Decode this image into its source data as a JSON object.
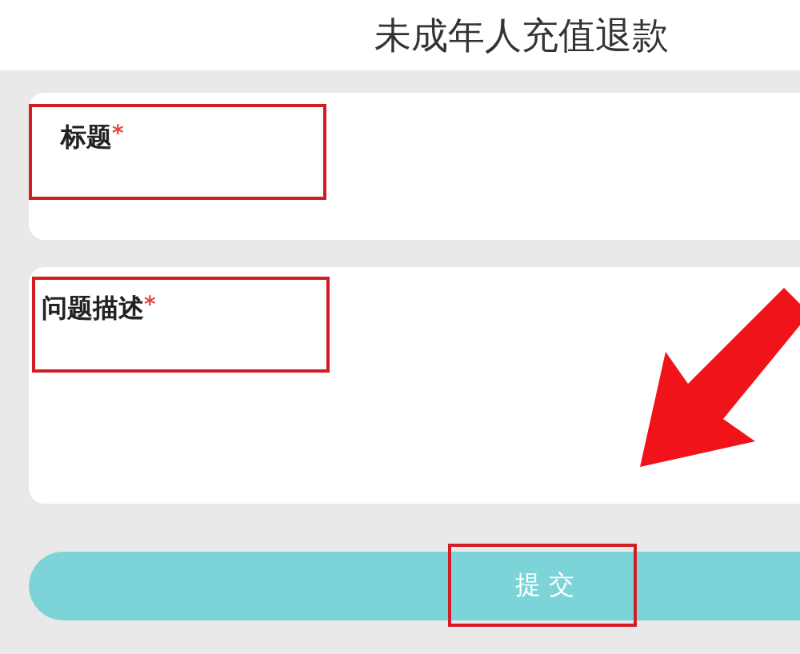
{
  "header": {
    "title": "未成年人充值退款"
  },
  "fields": [
    {
      "label": "标题",
      "mark": "*",
      "kind": "line"
    },
    {
      "label": "问题描述",
      "mark": "*",
      "kind": "area"
    }
  ],
  "submit_button": {
    "label": "提 交"
  }
}
